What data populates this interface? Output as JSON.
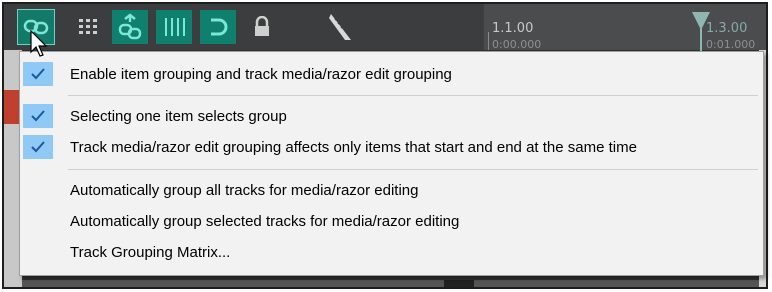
{
  "ruler": {
    "marker1_top": "1.1.00",
    "marker1_bottom": "0:00.000",
    "marker2_top": "1.3.00",
    "marker2_bottom": "0:01.000"
  },
  "toolbar": {
    "icons": [
      "link-group-icon",
      "grid-icon",
      "group-items-icon",
      "snap-grid-icon",
      "loop-icon",
      "lock-icon",
      "metronome-icon"
    ]
  },
  "menu": {
    "items": [
      {
        "label": "Enable item grouping and track media/razor edit grouping",
        "checked": true
      },
      {
        "label": "Selecting one item selects group",
        "checked": true
      },
      {
        "label": "Track media/razor edit grouping affects only items that start and end at the same time",
        "checked": true
      },
      {
        "label": "Automatically group all tracks for media/razor editing",
        "checked": false
      },
      {
        "label": "Automatically group selected tracks for media/razor editing",
        "checked": false
      },
      {
        "label": "Track Grouping Matrix...",
        "checked": false
      }
    ]
  },
  "colors": {
    "toolbar_accent": "#137a69",
    "check_highlight": "#90c8f6",
    "menu_background": "#f2f2f2"
  }
}
